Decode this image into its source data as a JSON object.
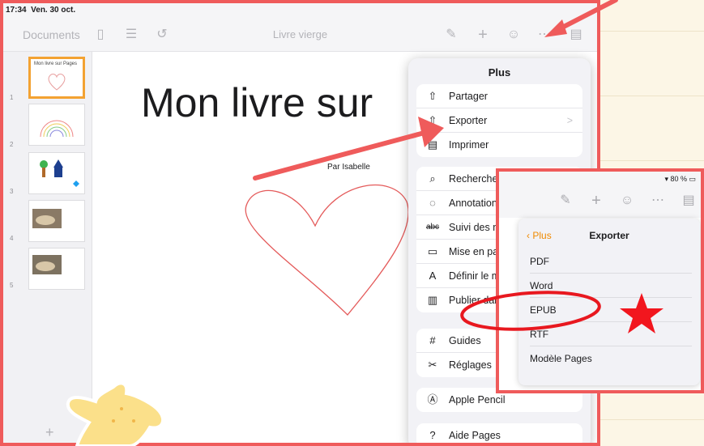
{
  "status_bar": {
    "time": "17:34",
    "date": "Ven. 30 oct."
  },
  "toolbar": {
    "documents_label": "Documents",
    "doc_title": "Livre vierge",
    "icons": [
      "sidebar-icon",
      "list-icon",
      "undo-icon",
      "paintbrush-icon",
      "plus-icon",
      "collaborate-icon",
      "more-icon",
      "document-settings-icon"
    ]
  },
  "sidebar": {
    "pages": [
      {
        "number": "1",
        "title": "Mon livre sur Pages"
      },
      {
        "number": "2",
        "title": ""
      },
      {
        "number": "3",
        "title": ""
      },
      {
        "number": "4",
        "title": ""
      },
      {
        "number": "5",
        "title": ""
      }
    ],
    "add_label": "+"
  },
  "page": {
    "title": "Mon livre sur",
    "author": "Par Isabelle"
  },
  "plus_menu": {
    "title": "Plus",
    "group1": [
      {
        "label": "Partager",
        "icon": "share-icon"
      },
      {
        "label": "Exporter",
        "icon": "export-icon",
        "chevron": ">"
      },
      {
        "label": "Imprimer",
        "icon": "print-icon"
      }
    ],
    "group2": [
      {
        "label": "Rechercher",
        "icon": "search-icon"
      },
      {
        "label": "Annotation i",
        "icon": "annotation-icon"
      },
      {
        "label": "Suivi des mo",
        "icon": "track-changes-icon"
      },
      {
        "label": "Mise en pag",
        "icon": "page-layout-icon"
      },
      {
        "label": "Définir le mo",
        "icon": "define-icon"
      },
      {
        "label": "Publier dans",
        "icon": "book-icon"
      }
    ],
    "group3": [
      {
        "label": "Guides",
        "icon": "guides-icon"
      },
      {
        "label": "Réglages",
        "icon": "wrench-icon"
      }
    ],
    "group4": [
      {
        "label": "Apple Pencil",
        "icon": "pencil-icon"
      }
    ],
    "group5": [
      {
        "label": "Aide Pages",
        "icon": "help-icon"
      }
    ]
  },
  "inset": {
    "status": "80 %",
    "back_label": "Plus",
    "title": "Exporter",
    "items": [
      "PDF",
      "Word",
      "EPUB",
      "RTF",
      "Modèle Pages"
    ]
  },
  "colors": {
    "annotation": "#ef5b5b",
    "accent": "#f08a00",
    "selected_page": "#f3a232"
  }
}
